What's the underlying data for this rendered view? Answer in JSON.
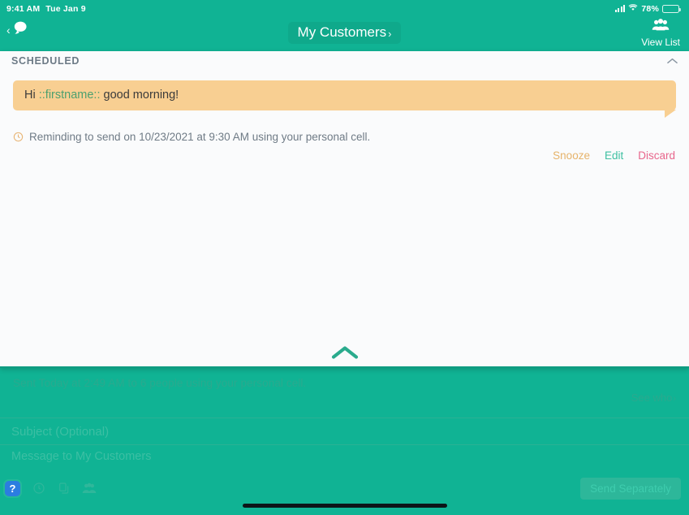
{
  "status_bar": {
    "time": "9:41 AM",
    "date": "Tue Jan 9",
    "battery_percent": "78%",
    "signal_icon": "signal-bars-icon",
    "wifi_icon": "wifi-icon",
    "battery_icon": "battery-icon"
  },
  "nav": {
    "back_icon": "back-chevron-icon",
    "messages_icon": "chat-bubble-icon",
    "title": "My Customers",
    "title_chevron": "›",
    "view_list_label": "View List",
    "view_list_icon": "people-group-icon"
  },
  "panel": {
    "section_title": "SCHEDULED",
    "collapse_icon": "chevron-up-icon",
    "message": {
      "prefix": "Hi ",
      "token": "::firstname::",
      "suffix": " good morning!"
    },
    "reminder": {
      "icon": "clock-icon",
      "text": "Reminding to send on 10/23/2021 at 9:30 AM using your personal cell."
    },
    "actions": {
      "snooze": "Snooze",
      "edit": "Edit",
      "discard": "Discard"
    },
    "collapse_big_icon": "chevron-up-large-icon"
  },
  "background": {
    "sent_status": "Sent Today at 2:49 AM to 6 people using your personal cell.",
    "see_who_label": "See who",
    "see_who_chevron": "›",
    "subject_placeholder": "Subject (Optional)",
    "message_placeholder": "Message to My Customers",
    "toolbar": {
      "help_label": "?",
      "schedule_icon": "clock-icon",
      "templates_icon": "templates-icon",
      "recipients_icon": "people-group-icon"
    },
    "send_button": "Send Separately"
  },
  "colors": {
    "brand_green": "#10b394",
    "panel_bg": "#fafbfc",
    "bubble_bg": "#f8cf92",
    "token_green": "#4da06f",
    "snooze": "#e6b36a",
    "edit": "#3fc0a2",
    "discard": "#e8668c",
    "help_blue": "#2b7de0"
  }
}
